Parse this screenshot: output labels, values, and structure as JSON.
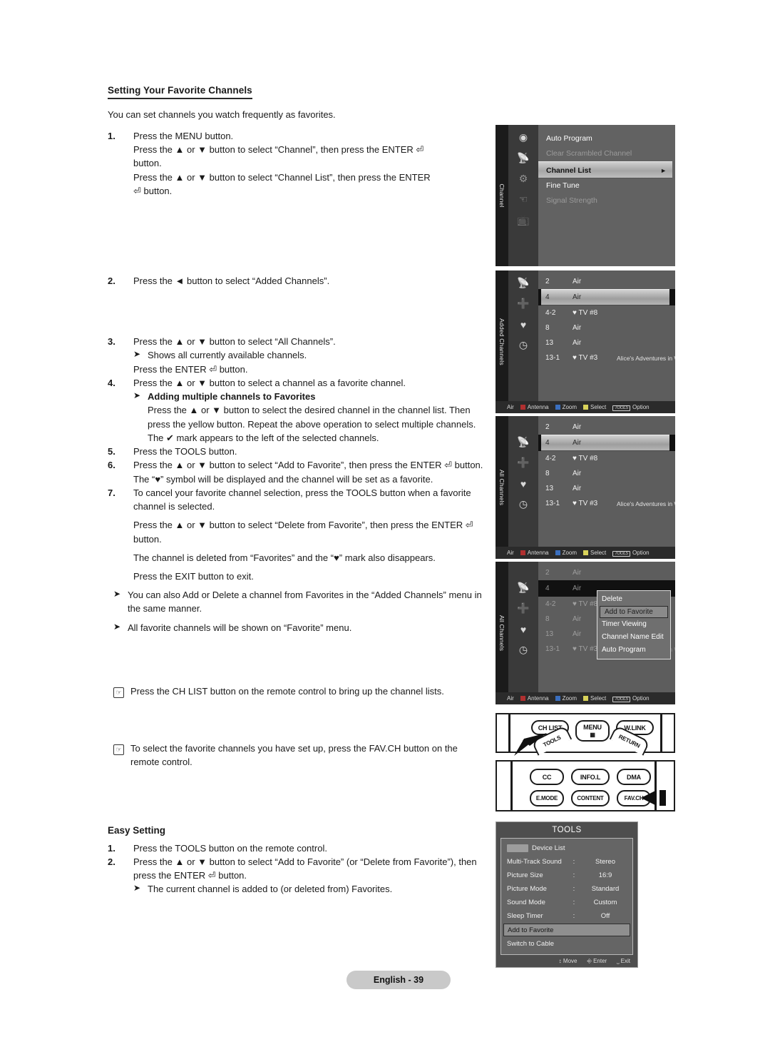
{
  "doc": {
    "section_title": "Setting Your Favorite Channels",
    "intro": "You can set channels you watch frequently as favorites.",
    "easy_title": "Easy Setting",
    "page_label": "English - 39"
  },
  "steps": {
    "s1_num": "1.",
    "s1_l1": "Press the MENU button.",
    "s1_l2": "Press the ▲ or ▼ button to select “Channel”, then press the ENTER ⏎",
    "s1_l3": "button.",
    "s1_l4": "Press the ▲ or ▼ button to select “Channel List”, then press the ENTER",
    "s1_l5": "⏎ button.",
    "s2_num": "2.",
    "s2_l1": "Press the ◄ button to select “Added Channels”.",
    "s3_num": "3.",
    "s3_l1": "Press the ▲ or ▼ button to select “All Channels”.",
    "s3_b1": "Shows all currently available channels.",
    "s3_l2": "Press the ENTER ⏎ button.",
    "s4_num": "4.",
    "s4_l1": "Press the ▲ or ▼ button to select a channel as a favorite channel.",
    "s4_b1_title": "Adding multiple channels to Favorites",
    "s4_b1_body": "Press the ▲ or ▼ button to select the desired channel in the channel list. Then press the yellow button. Repeat the above operation to select multiple channels. The ✔ mark appears to the left of the selected channels.",
    "s5_num": "5.",
    "s5_l1": "Press the TOOLS button.",
    "s6_num": "6.",
    "s6_l1": "Press the ▲ or ▼ button to select “Add to Favorite”, then press the ENTER ⏎ button. The “♥” symbol will be displayed and the channel will be set as a favorite.",
    "s7_num": "7.",
    "s7_l1": "To cancel your favorite channel selection, press the TOOLS button when a favorite channel is selected.",
    "s7_l2": "Press the ▲ or ▼ button to select “Delete from Favorite”, then press the ENTER ⏎ button.",
    "s7_l3": "The channel is deleted from “Favorites” and the “♥” mark also disappears.",
    "s7_l4": "Press the EXIT button to exit.",
    "note1": "You can also Add or Delete a channel from Favorites in the “Added Channels” menu in the same manner.",
    "note2": "All favorite channels will be shown on “Favorite” menu.",
    "hand1": "Press the CH LIST button on the remote control to bring up the channel lists.",
    "hand2": "To select the favorite channels you have set up, press the FAV.CH button on the remote control.",
    "e1_num": "1.",
    "e1_l1": "Press the TOOLS button on the remote control.",
    "e2_num": "2.",
    "e2_l1": "Press the ▲ or ▼ button to select “Add to Favorite” (or “Delete from Favorite”), then press the ENTER ⏎ button.",
    "e2_b1": "The current channel is added to (or deleted from) Favorites."
  },
  "osd_channel_menu": {
    "tab_label": "Channel",
    "rows": [
      {
        "label": "Auto Program",
        "state": "normal"
      },
      {
        "label": "Clear Scrambled Channel",
        "state": "dim"
      },
      {
        "label": "Channel List",
        "state": "selected",
        "arrow": "►"
      },
      {
        "label": "Fine Tune",
        "state": "normal"
      },
      {
        "label": "Signal Strength",
        "state": "dim"
      }
    ],
    "icons": [
      "antenna-icon",
      "channel-icon",
      "gear-icon",
      "hand-icon",
      "screen-icon"
    ]
  },
  "osd_added_channels": {
    "tab_label": "Added Channels",
    "icons": [
      "all-channels-icon",
      "added-channels-icon",
      "favorite-heart-icon",
      "clock-icon"
    ],
    "rows": [
      {
        "num": "2",
        "name": "Air",
        "desc": "",
        "fav": false,
        "sel": false
      },
      {
        "num": "4",
        "name": "Air",
        "desc": "",
        "fav": false,
        "sel": true
      },
      {
        "num": "4-2",
        "name": "TV #8",
        "desc": "",
        "fav": true,
        "sel": false
      },
      {
        "num": "8",
        "name": "Air",
        "desc": "",
        "fav": false,
        "sel": false
      },
      {
        "num": "13",
        "name": "Air",
        "desc": "",
        "fav": false,
        "sel": false
      },
      {
        "num": "13-1",
        "name": "TV #3",
        "desc": "Alice's Adventures in Wonderland",
        "fav": true,
        "sel": false
      }
    ],
    "footer": {
      "source": "Air",
      "antenna": "Antenna",
      "zoom": "Zoom",
      "select": "Select",
      "tools": "TOOLS",
      "option": "Option"
    }
  },
  "osd_all_channels": {
    "tab_label": "All Channels",
    "icons": [
      "all-channels-icon",
      "added-channels-icon",
      "favorite-heart-icon",
      "clock-icon"
    ],
    "rows": [
      {
        "num": "2",
        "name": "Air",
        "desc": "",
        "fav": false,
        "sel": false
      },
      {
        "num": "4",
        "name": "Air",
        "desc": "",
        "fav": false,
        "sel": true
      },
      {
        "num": "4-2",
        "name": "TV #8",
        "desc": "",
        "fav": true,
        "sel": false
      },
      {
        "num": "8",
        "name": "Air",
        "desc": "",
        "fav": false,
        "sel": false
      },
      {
        "num": "13",
        "name": "Air",
        "desc": "",
        "fav": false,
        "sel": false
      },
      {
        "num": "13-1",
        "name": "TV #3",
        "desc": "Alice's Adventures in Wonderland",
        "fav": true,
        "sel": false
      }
    ]
  },
  "osd_all_channels_popup": {
    "tab_label": "All Channels",
    "popup_items": [
      {
        "label": "Delete",
        "sel": false
      },
      {
        "label": "Add to Favorite",
        "sel": true
      },
      {
        "label": "Timer Viewing",
        "sel": false
      },
      {
        "label": "Channel Name Edit",
        "sel": false
      },
      {
        "label": "Auto Program",
        "sel": false
      }
    ]
  },
  "remote_top": {
    "row1": [
      "CH LIST",
      "MENU",
      "W.LINK"
    ],
    "row2": [
      "TOOLS",
      "RETURN"
    ],
    "pointer": "arrow-pointing-chlist"
  },
  "remote_bottom": {
    "row1": [
      "CC",
      "INFO.L",
      "DMA"
    ],
    "row2": [
      "E.MODE",
      "CONTENT",
      "FAV.CH"
    ],
    "pointer": "arrow-pointing-favch"
  },
  "tools_panel": {
    "title": "TOOLS",
    "rows": [
      {
        "label": "Device List",
        "sep": "",
        "value": "",
        "badge": true,
        "sel": false
      },
      {
        "label": "Multi-Track Sound",
        "sep": ":",
        "value": "Stereo",
        "sel": false
      },
      {
        "label": "Picture Size",
        "sep": ":",
        "value": "16:9",
        "sel": false
      },
      {
        "label": "Picture Mode",
        "sep": ":",
        "value": "Standard",
        "sel": false
      },
      {
        "label": "Sound Mode",
        "sep": ":",
        "value": "Custom",
        "sel": false
      },
      {
        "label": "Sleep Timer",
        "sep": ":",
        "value": "Off",
        "sel": false
      },
      {
        "label": "Add to Favorite",
        "sep": "",
        "value": "",
        "sel": true
      },
      {
        "label": "Switch to Cable",
        "sep": "",
        "value": "",
        "sel": false
      }
    ],
    "footer": {
      "move": "Move",
      "enter": "Enter",
      "exit": "Exit"
    }
  }
}
